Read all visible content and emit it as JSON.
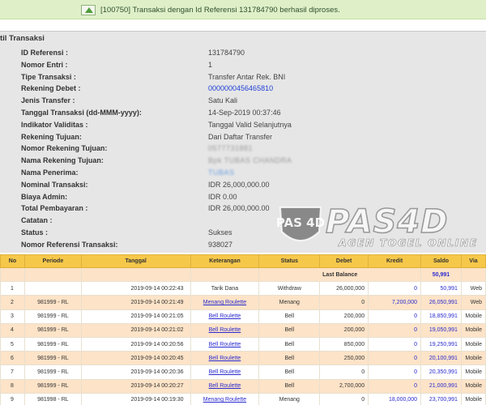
{
  "banner": {
    "message": "[100750] Transaksi dengan Id Referensi 131784790 berhasil diproses."
  },
  "detail": {
    "heading": "til Transaksi",
    "rows": [
      {
        "label": "ID Referensi :",
        "value": "131784790",
        "style": ""
      },
      {
        "label": "Nomor Entri :",
        "value": "1",
        "style": ""
      },
      {
        "label": "Tipe Transaksi :",
        "value": "Transfer Antar Rek. BNI",
        "style": ""
      },
      {
        "label": "Rekening Debet :",
        "value": "0000000456465810",
        "style": "blue"
      },
      {
        "label": "Jenis Transfer :",
        "value": "Satu Kali",
        "style": ""
      },
      {
        "label": "Tanggal Transaksi (dd-MMM-yyyy):",
        "value": "14-Sep-2019 00:37:46",
        "style": ""
      },
      {
        "label": "Indikator Validitas :",
        "value": "Tanggal Valid Selanjutnya",
        "style": ""
      },
      {
        "label": "Rekening Tujuan:",
        "value": "Dari Daftar Transfer",
        "style": ""
      },
      {
        "label": "Nomor Rekening Tujuan:",
        "value": "0577731881",
        "style": "blur"
      },
      {
        "label": "Nama Rekening Tujuan:",
        "value": "Bpk TUBAS CHANDRA",
        "style": "blur"
      },
      {
        "label": "Nama Penerima:",
        "value": "TUBAS",
        "style": "blur-blue"
      },
      {
        "label": "Nominal Transaksi:",
        "value": "IDR 26,000,000.00",
        "style": ""
      },
      {
        "label": "Biaya Admin:",
        "value": "IDR 0.00",
        "style": ""
      },
      {
        "label": "Total Pembayaran :",
        "value": "IDR 26,000,000.00",
        "style": ""
      },
      {
        "label": "Catatan :",
        "value": "",
        "style": ""
      },
      {
        "label": "Status :",
        "value": "Sukses",
        "style": ""
      },
      {
        "label": "Nomor Referensi Transaksi:",
        "value": "938027",
        "style": ""
      }
    ]
  },
  "logo": {
    "word": "PAS4D",
    "tagline": "AGEN TOGEL ONLINE",
    "badge_text": "PAS 4D"
  },
  "table": {
    "headers": [
      "No",
      "Periode",
      "Tanggal",
      "Keterangan",
      "Status",
      "Debet",
      "Kredit",
      "Saldo",
      "Via"
    ],
    "balance_row": {
      "label": "Last Balance",
      "value": "50,991"
    },
    "rows": [
      {
        "no": "1",
        "periode": "",
        "tanggal": "2019-09-14 00:22:43",
        "ket": "Tarik Dana",
        "ket_link": false,
        "status": "Withdraw",
        "debet": "26,000,000",
        "kredit": "0",
        "saldo": "50,991",
        "via": "Web"
      },
      {
        "no": "2",
        "periode": "981999 - RL",
        "tanggal": "2019-09-14 00:21:49",
        "ket": "Menang Roulette",
        "ket_link": true,
        "status": "Menang",
        "debet": "0",
        "kredit": "7,200,000",
        "saldo": "26,050,991",
        "via": "Web"
      },
      {
        "no": "3",
        "periode": "981999 - RL",
        "tanggal": "2019-09-14 00:21:05",
        "ket": "Bell Roulette",
        "ket_link": true,
        "status": "Bell",
        "debet": "200,000",
        "kredit": "0",
        "saldo": "18,850,991",
        "via": "Mobile"
      },
      {
        "no": "4",
        "periode": "981999 - RL",
        "tanggal": "2019-09-14 00:21:02",
        "ket": "Bell Roulette",
        "ket_link": true,
        "status": "Bell",
        "debet": "200,000",
        "kredit": "0",
        "saldo": "19,050,991",
        "via": "Mobile"
      },
      {
        "no": "5",
        "periode": "981999 - RL",
        "tanggal": "2019-09-14 00:20:56",
        "ket": "Bell Roulette",
        "ket_link": true,
        "status": "Bell",
        "debet": "850,000",
        "kredit": "0",
        "saldo": "19,250,991",
        "via": "Mobile"
      },
      {
        "no": "6",
        "periode": "981999 - RL",
        "tanggal": "2019-09-14 00:20:45",
        "ket": "Bell Roulette",
        "ket_link": true,
        "status": "Bell",
        "debet": "250,000",
        "kredit": "0",
        "saldo": "20,100,991",
        "via": "Mobile"
      },
      {
        "no": "7",
        "periode": "981999 - RL",
        "tanggal": "2019-09-14 00:20:36",
        "ket": "Bell Roulette",
        "ket_link": true,
        "status": "Bell",
        "debet": "0",
        "kredit": "0",
        "saldo": "20,350,991",
        "via": "Mobile"
      },
      {
        "no": "8",
        "periode": "981999 - RL",
        "tanggal": "2019-09-14 00:20:27",
        "ket": "Bell Roulette",
        "ket_link": true,
        "status": "Bell",
        "debet": "2,700,000",
        "kredit": "0",
        "saldo": "21,000,991",
        "via": "Mobile"
      },
      {
        "no": "9",
        "periode": "981998 - RL",
        "tanggal": "2019-09-14 00:19:30",
        "ket": "Menang Roulette",
        "ket_link": true,
        "status": "Menang",
        "debet": "0",
        "kredit": "18,000,000",
        "saldo": "23,700,991",
        "via": "Mobile"
      }
    ]
  },
  "colors": {
    "banner_bg": "#dff0c8",
    "panel_bg": "#e6e6e6",
    "header_bg": "#f6c84a",
    "stripe_bg": "#fde3c7",
    "link_blue": "#2b2bd0"
  }
}
